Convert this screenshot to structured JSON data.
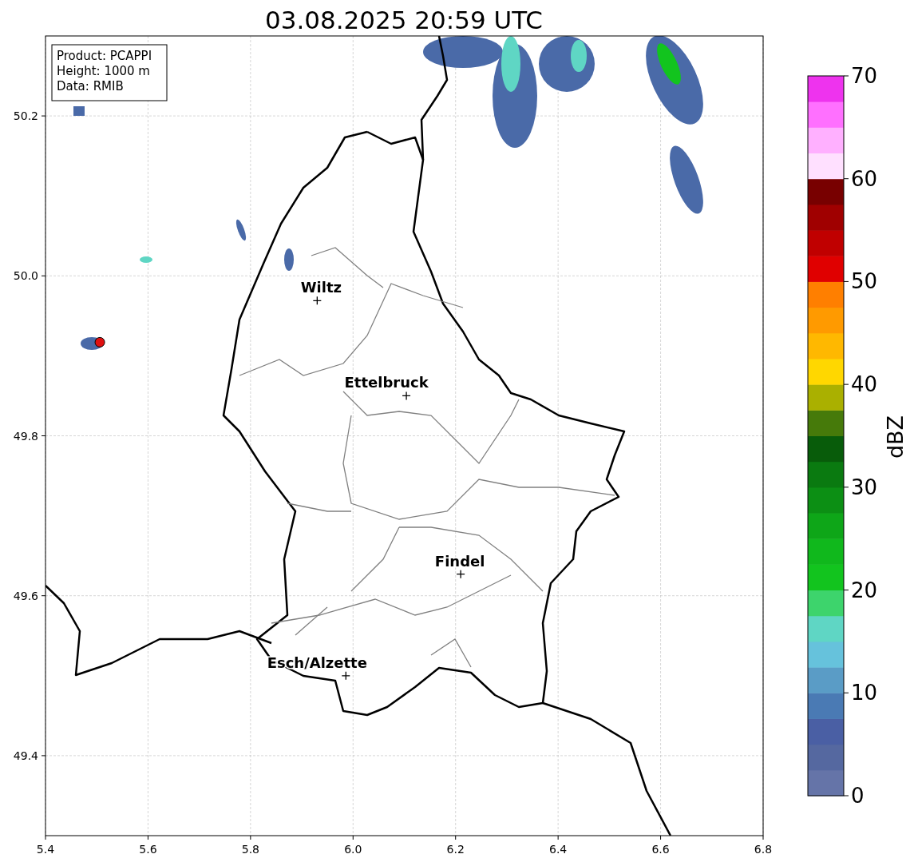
{
  "title": "03.08.2025 20:59 UTC",
  "info_box": [
    "Product: PCAPPI",
    "Height: 1000 m",
    "Data: RMIB"
  ],
  "map": {
    "x_ticks": [
      "5.4",
      "5.6",
      "5.8",
      "6.0",
      "6.2",
      "6.4",
      "6.6",
      "6.8"
    ],
    "y_ticks": [
      "50.2",
      "50.0",
      "49.8",
      "49.6",
      "49.4"
    ],
    "cities": [
      {
        "name": "Wiltz"
      },
      {
        "name": "Ettelbruck"
      },
      {
        "name": "Findel"
      },
      {
        "name": "Esch/Alzette"
      }
    ]
  },
  "colorbar": {
    "label": "dBZ",
    "ticks": [
      "70",
      "60",
      "50",
      "40",
      "30",
      "20",
      "10",
      "0"
    ],
    "bands": [
      {
        "color": "#6574a8"
      },
      {
        "color": "#5568a0"
      },
      {
        "color": "#4a5fa4"
      },
      {
        "color": "#4a7ab4"
      },
      {
        "color": "#5a9cc6"
      },
      {
        "color": "#66c2dc"
      },
      {
        "color": "#5fd6c4"
      },
      {
        "color": "#3dd46c"
      },
      {
        "color": "#12c41e"
      },
      {
        "color": "#10b81c"
      },
      {
        "color": "#0ea618"
      },
      {
        "color": "#0c8f14"
      },
      {
        "color": "#0a7a10"
      },
      {
        "color": "#085c0a"
      },
      {
        "color": "#467a0a"
      },
      {
        "color": "#aab000"
      },
      {
        "color": "#ffd700"
      },
      {
        "color": "#ffb800"
      },
      {
        "color": "#ff9a00"
      },
      {
        "color": "#ff7f00"
      },
      {
        "color": "#e00000"
      },
      {
        "color": "#c00000"
      },
      {
        "color": "#a00000"
      },
      {
        "color": "#780000"
      },
      {
        "color": "#ffe0ff"
      },
      {
        "color": "#ffb0ff"
      },
      {
        "color": "#ff70ff"
      },
      {
        "color": "#ee33ee"
      }
    ]
  }
}
